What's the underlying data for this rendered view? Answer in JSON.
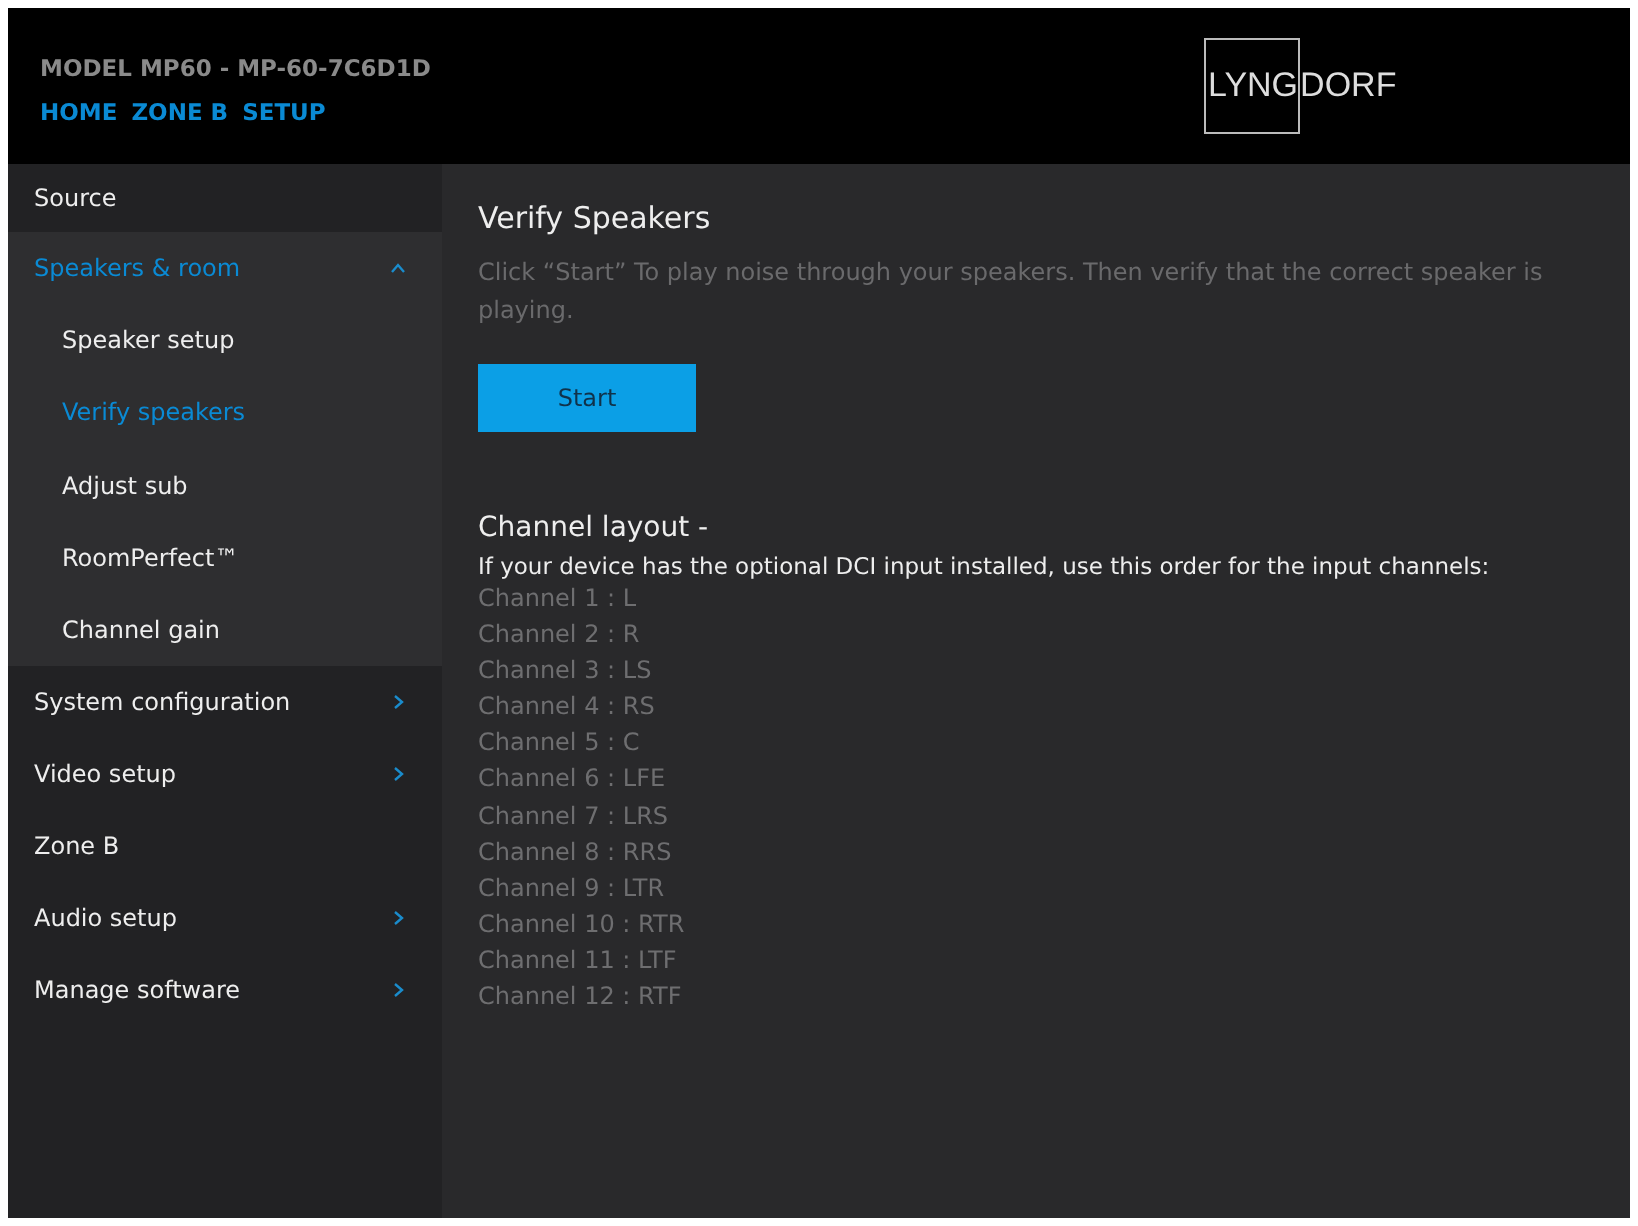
{
  "header": {
    "model": "MODEL MP60 - MP-60-7C6D1D",
    "nav": [
      "HOME",
      "ZONE B",
      "SETUP"
    ],
    "logo": {
      "boxed": "LYNG",
      "rest": "DORF"
    }
  },
  "sidebar": {
    "items": [
      {
        "label": "Source",
        "selected": false,
        "submenu": false
      },
      {
        "label": "Speakers & room",
        "selected": true,
        "submenu": true,
        "expanded": true,
        "children": [
          {
            "label": "Speaker setup",
            "selected": false
          },
          {
            "label": "Verify speakers",
            "selected": true
          },
          {
            "label": "Adjust sub",
            "selected": false
          },
          {
            "label": "RoomPerfect™",
            "selected": false
          },
          {
            "label": "Channel gain",
            "selected": false
          }
        ]
      },
      {
        "label": "System configuration",
        "selected": false,
        "submenu": true,
        "expanded": false
      },
      {
        "label": "Video setup",
        "selected": false,
        "submenu": true,
        "expanded": false
      },
      {
        "label": "Zone B",
        "selected": false,
        "submenu": false
      },
      {
        "label": "Audio setup",
        "selected": false,
        "submenu": true,
        "expanded": false
      },
      {
        "label": "Manage software",
        "selected": false,
        "submenu": true,
        "expanded": false
      }
    ]
  },
  "main": {
    "title": "Verify Speakers",
    "description": "Click “Start” To play noise through your speakers. Then verify that the correct speaker is playing.",
    "start_button": "Start",
    "layout_title": "Channel layout -",
    "layout_note": "If your device has the optional DCI input installed, use this order for the input channels:",
    "channels": [
      "Channel 1 : L",
      "Channel 2 : R",
      "Channel 3 : LS",
      "Channel 4 : RS",
      "Channel 5 : C",
      "Channel 6 : LFE",
      "Channel 7 : LRS",
      "Channel 8 : RRS",
      "Channel 9 : LTR",
      "Channel 10 : RTR",
      "Channel 11 : LTF",
      "Channel 12 : RTF"
    ]
  }
}
